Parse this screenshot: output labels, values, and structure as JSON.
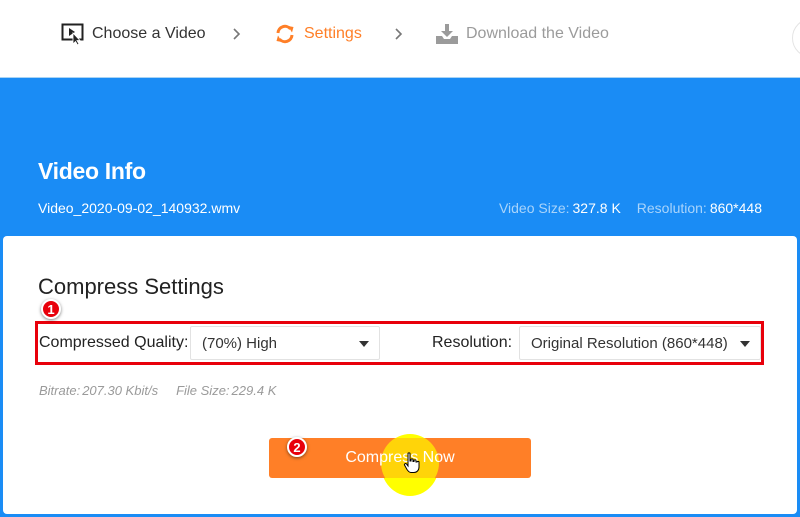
{
  "steps": [
    {
      "label": "Choose a Video",
      "icon": "video-select-icon",
      "state": "done"
    },
    {
      "label": "Settings",
      "icon": "refresh-icon",
      "state": "active"
    },
    {
      "label": "Download the Video",
      "icon": "download-icon",
      "state": "pending"
    }
  ],
  "colors": {
    "accent": "#ff7f27",
    "hero_blue": "#1a8cf5",
    "highlight_red": "#e8000b"
  },
  "video_info": {
    "title": "Video Info",
    "filename": "Video_2020-09-02_140932.wmv",
    "size_label": "Video Size:",
    "size_value": "327.8 K",
    "resolution_label": "Resolution:",
    "resolution_value": "860*448"
  },
  "compress": {
    "title": "Compress Settings",
    "quality_label": "Compressed Quality:",
    "quality_value": "(70%) High",
    "resolution_label": "Resolution:",
    "resolution_value": "Original Resolution (860*448)",
    "bitrate_label": "Bitrate:",
    "bitrate_value": "207.30 Kbit/s",
    "filesize_label": "File Size:",
    "filesize_value": "229.4 K",
    "button_label": "Compress Now"
  },
  "annotations": {
    "badge1": "1",
    "badge2": "2"
  }
}
